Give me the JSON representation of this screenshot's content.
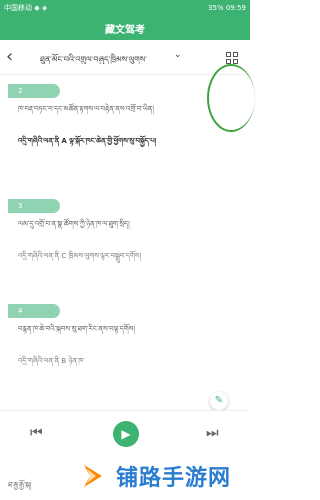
{
  "status": {
    "left": "中国移动 ◆ ◈",
    "right": "35%  09:59"
  },
  "title": "藏文驾考",
  "subheader": {
    "chapter": "ཐུན་མོང་བའི་འགྲུལ་བཞུད་ཁྲིམས་ལུགས་",
    "dropdown_icon": "chevron-down-icon",
    "grid_icon": "grid-icon"
  },
  "questions": [
    {
      "badge": "2",
      "text": "ཁ་བརྡ་བཏང་བ་དང་མཚོན་རྟགས་ལ་བརྟེན་ནས་འགྲོ་བ་ཡིན།",
      "answer_label": "འདྲི་གཞིའི་ལན་ནི",
      "answer_value": "A",
      "answer_text": "ལྟ་སྐོར་ཁང་ཆེན་གྱི་ཕྱོགས་སུ་བསྐྱོད་པ།"
    },
    {
      "badge": "3",
      "text": "ལམ་དུ་འགྲོ་བ་ན་སྣ་ཚོགས་ཀྱི་ཉེན་ཁ་ལ་ཐུག་སྲིད།",
      "answer_label": "འདྲི་གཞིའི་ལན་ནི",
      "answer_value": "C",
      "answer_text": "ཁྲིམས་ལུགས་ལྟར་བསྒྲུབ་དགོས།"
    },
    {
      "badge": "4",
      "text": "བརྙན་ཁ་ཆེ་བའི་སྐབས་སུ་ཐག་རིང་ནས་བལྟ་དགོས།",
      "answer_label": "འདྲི་གཞིའི་ལན་ནི",
      "answer_value": "B",
      "answer_text": "ཉེན་ཁ་"
    }
  ],
  "controls": {
    "prev_icon": "skip-back-icon",
    "play_icon": "play-icon",
    "next_icon": "skip-forward-icon"
  },
  "bottom": {
    "small_text": "ཐ་རྒྱ་རྒྱོ་སྐ།",
    "watermark": "铺路手游网"
  }
}
